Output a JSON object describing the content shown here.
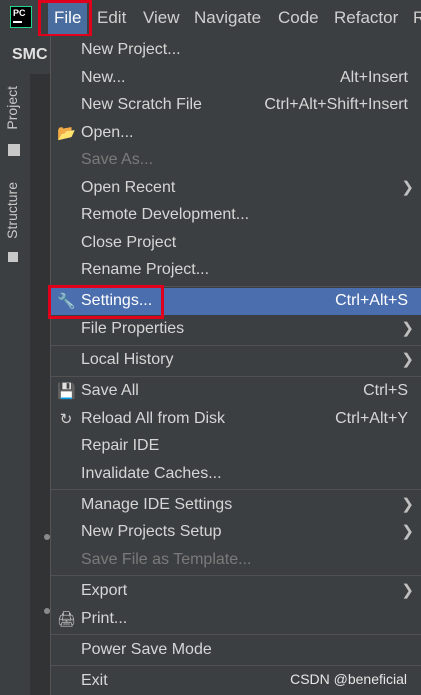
{
  "app_logo": "PC",
  "menubar": {
    "items": [
      "File",
      "Edit",
      "View",
      "Navigate",
      "Code",
      "Refactor",
      "R"
    ]
  },
  "project_name": "SMC",
  "tool_windows": {
    "project": "Project",
    "structure": "Structure"
  },
  "file_menu": {
    "items": [
      {
        "label": "New Project...",
        "shortcut": ""
      },
      {
        "label": "New...",
        "shortcut": "Alt+Insert"
      },
      {
        "label": "New Scratch File",
        "shortcut": "Ctrl+Alt+Shift+Insert"
      },
      {
        "label": "Open...",
        "shortcut": "",
        "icon": "folder-icon"
      },
      {
        "label": "Save As...",
        "shortcut": "",
        "disabled": true
      },
      {
        "label": "Open Recent",
        "submenu": true
      },
      {
        "label": "Remote Development...",
        "shortcut": ""
      },
      {
        "label": "Close Project",
        "shortcut": ""
      },
      {
        "label": "Rename Project...",
        "shortcut": ""
      },
      {
        "label": "Settings...",
        "shortcut": "Ctrl+Alt+S",
        "icon": "wrench-icon",
        "selected": true
      },
      {
        "label": "File Properties",
        "submenu": true
      },
      {
        "label": "Local History",
        "submenu": true
      },
      {
        "label": "Save All",
        "shortcut": "Ctrl+S",
        "icon": "save-icon"
      },
      {
        "label": "Reload All from Disk",
        "shortcut": "Ctrl+Alt+Y",
        "icon": "reload-icon"
      },
      {
        "label": "Repair IDE",
        "shortcut": ""
      },
      {
        "label": "Invalidate Caches...",
        "shortcut": ""
      },
      {
        "label": "Manage IDE Settings",
        "submenu": true
      },
      {
        "label": "New Projects Setup",
        "submenu": true
      },
      {
        "label": "Save File as Template...",
        "shortcut": "",
        "disabled": true
      },
      {
        "label": "Export",
        "submenu": true
      },
      {
        "label": "Print...",
        "shortcut": "",
        "icon": "print-icon"
      },
      {
        "label": "Power Save Mode",
        "shortcut": ""
      },
      {
        "label": "Exit",
        "shortcut": ""
      }
    ]
  },
  "watermark": "CSDN @beneficial",
  "colors": {
    "selection": "#4b6eaf",
    "highlight_box": "#e0001b",
    "menu_bg": "#3c3f41"
  }
}
